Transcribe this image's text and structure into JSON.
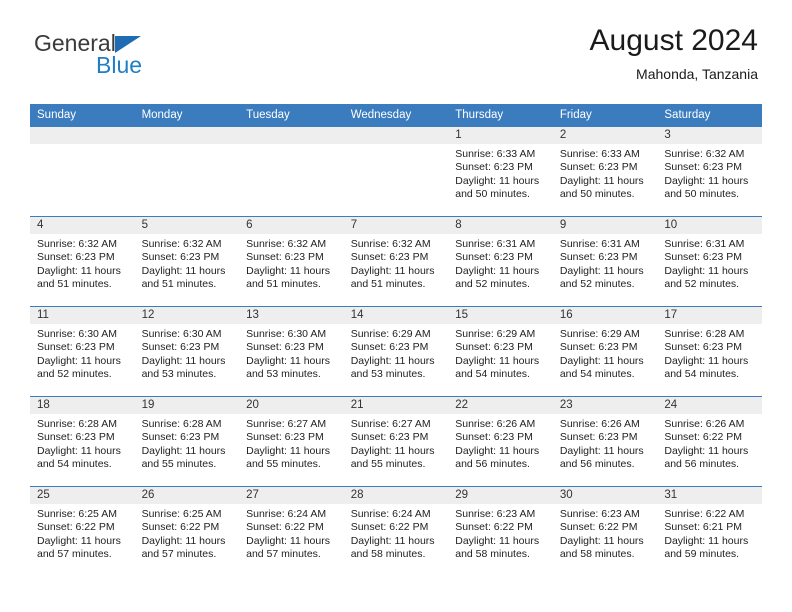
{
  "brand": {
    "name_part1": "General",
    "name_part2": "Blue",
    "logo_icon": "triangle-flag-icon",
    "accent_color": "#1f7ec6"
  },
  "header": {
    "title": "August 2024",
    "subtitle": "Mahonda, Tanzania"
  },
  "theme": {
    "header_row_color": "#3a7cbe",
    "date_band_color": "#eeeeee",
    "grid_line_color": "#3a7cbe"
  },
  "weekdays": [
    "Sunday",
    "Monday",
    "Tuesday",
    "Wednesday",
    "Thursday",
    "Friday",
    "Saturday"
  ],
  "weeks": [
    [
      {
        "day": "",
        "sunrise": "",
        "sunset": "",
        "daylight_line1": "",
        "daylight_line2": ""
      },
      {
        "day": "",
        "sunrise": "",
        "sunset": "",
        "daylight_line1": "",
        "daylight_line2": ""
      },
      {
        "day": "",
        "sunrise": "",
        "sunset": "",
        "daylight_line1": "",
        "daylight_line2": ""
      },
      {
        "day": "",
        "sunrise": "",
        "sunset": "",
        "daylight_line1": "",
        "daylight_line2": ""
      },
      {
        "day": "1",
        "sunrise": "Sunrise: 6:33 AM",
        "sunset": "Sunset: 6:23 PM",
        "daylight_line1": "Daylight: 11 hours",
        "daylight_line2": "and 50 minutes."
      },
      {
        "day": "2",
        "sunrise": "Sunrise: 6:33 AM",
        "sunset": "Sunset: 6:23 PM",
        "daylight_line1": "Daylight: 11 hours",
        "daylight_line2": "and 50 minutes."
      },
      {
        "day": "3",
        "sunrise": "Sunrise: 6:32 AM",
        "sunset": "Sunset: 6:23 PM",
        "daylight_line1": "Daylight: 11 hours",
        "daylight_line2": "and 50 minutes."
      }
    ],
    [
      {
        "day": "4",
        "sunrise": "Sunrise: 6:32 AM",
        "sunset": "Sunset: 6:23 PM",
        "daylight_line1": "Daylight: 11 hours",
        "daylight_line2": "and 51 minutes."
      },
      {
        "day": "5",
        "sunrise": "Sunrise: 6:32 AM",
        "sunset": "Sunset: 6:23 PM",
        "daylight_line1": "Daylight: 11 hours",
        "daylight_line2": "and 51 minutes."
      },
      {
        "day": "6",
        "sunrise": "Sunrise: 6:32 AM",
        "sunset": "Sunset: 6:23 PM",
        "daylight_line1": "Daylight: 11 hours",
        "daylight_line2": "and 51 minutes."
      },
      {
        "day": "7",
        "sunrise": "Sunrise: 6:32 AM",
        "sunset": "Sunset: 6:23 PM",
        "daylight_line1": "Daylight: 11 hours",
        "daylight_line2": "and 51 minutes."
      },
      {
        "day": "8",
        "sunrise": "Sunrise: 6:31 AM",
        "sunset": "Sunset: 6:23 PM",
        "daylight_line1": "Daylight: 11 hours",
        "daylight_line2": "and 52 minutes."
      },
      {
        "day": "9",
        "sunrise": "Sunrise: 6:31 AM",
        "sunset": "Sunset: 6:23 PM",
        "daylight_line1": "Daylight: 11 hours",
        "daylight_line2": "and 52 minutes."
      },
      {
        "day": "10",
        "sunrise": "Sunrise: 6:31 AM",
        "sunset": "Sunset: 6:23 PM",
        "daylight_line1": "Daylight: 11 hours",
        "daylight_line2": "and 52 minutes."
      }
    ],
    [
      {
        "day": "11",
        "sunrise": "Sunrise: 6:30 AM",
        "sunset": "Sunset: 6:23 PM",
        "daylight_line1": "Daylight: 11 hours",
        "daylight_line2": "and 52 minutes."
      },
      {
        "day": "12",
        "sunrise": "Sunrise: 6:30 AM",
        "sunset": "Sunset: 6:23 PM",
        "daylight_line1": "Daylight: 11 hours",
        "daylight_line2": "and 53 minutes."
      },
      {
        "day": "13",
        "sunrise": "Sunrise: 6:30 AM",
        "sunset": "Sunset: 6:23 PM",
        "daylight_line1": "Daylight: 11 hours",
        "daylight_line2": "and 53 minutes."
      },
      {
        "day": "14",
        "sunrise": "Sunrise: 6:29 AM",
        "sunset": "Sunset: 6:23 PM",
        "daylight_line1": "Daylight: 11 hours",
        "daylight_line2": "and 53 minutes."
      },
      {
        "day": "15",
        "sunrise": "Sunrise: 6:29 AM",
        "sunset": "Sunset: 6:23 PM",
        "daylight_line1": "Daylight: 11 hours",
        "daylight_line2": "and 54 minutes."
      },
      {
        "day": "16",
        "sunrise": "Sunrise: 6:29 AM",
        "sunset": "Sunset: 6:23 PM",
        "daylight_line1": "Daylight: 11 hours",
        "daylight_line2": "and 54 minutes."
      },
      {
        "day": "17",
        "sunrise": "Sunrise: 6:28 AM",
        "sunset": "Sunset: 6:23 PM",
        "daylight_line1": "Daylight: 11 hours",
        "daylight_line2": "and 54 minutes."
      }
    ],
    [
      {
        "day": "18",
        "sunrise": "Sunrise: 6:28 AM",
        "sunset": "Sunset: 6:23 PM",
        "daylight_line1": "Daylight: 11 hours",
        "daylight_line2": "and 54 minutes."
      },
      {
        "day": "19",
        "sunrise": "Sunrise: 6:28 AM",
        "sunset": "Sunset: 6:23 PM",
        "daylight_line1": "Daylight: 11 hours",
        "daylight_line2": "and 55 minutes."
      },
      {
        "day": "20",
        "sunrise": "Sunrise: 6:27 AM",
        "sunset": "Sunset: 6:23 PM",
        "daylight_line1": "Daylight: 11 hours",
        "daylight_line2": "and 55 minutes."
      },
      {
        "day": "21",
        "sunrise": "Sunrise: 6:27 AM",
        "sunset": "Sunset: 6:23 PM",
        "daylight_line1": "Daylight: 11 hours",
        "daylight_line2": "and 55 minutes."
      },
      {
        "day": "22",
        "sunrise": "Sunrise: 6:26 AM",
        "sunset": "Sunset: 6:23 PM",
        "daylight_line1": "Daylight: 11 hours",
        "daylight_line2": "and 56 minutes."
      },
      {
        "day": "23",
        "sunrise": "Sunrise: 6:26 AM",
        "sunset": "Sunset: 6:23 PM",
        "daylight_line1": "Daylight: 11 hours",
        "daylight_line2": "and 56 minutes."
      },
      {
        "day": "24",
        "sunrise": "Sunrise: 6:26 AM",
        "sunset": "Sunset: 6:22 PM",
        "daylight_line1": "Daylight: 11 hours",
        "daylight_line2": "and 56 minutes."
      }
    ],
    [
      {
        "day": "25",
        "sunrise": "Sunrise: 6:25 AM",
        "sunset": "Sunset: 6:22 PM",
        "daylight_line1": "Daylight: 11 hours",
        "daylight_line2": "and 57 minutes."
      },
      {
        "day": "26",
        "sunrise": "Sunrise: 6:25 AM",
        "sunset": "Sunset: 6:22 PM",
        "daylight_line1": "Daylight: 11 hours",
        "daylight_line2": "and 57 minutes."
      },
      {
        "day": "27",
        "sunrise": "Sunrise: 6:24 AM",
        "sunset": "Sunset: 6:22 PM",
        "daylight_line1": "Daylight: 11 hours",
        "daylight_line2": "and 57 minutes."
      },
      {
        "day": "28",
        "sunrise": "Sunrise: 6:24 AM",
        "sunset": "Sunset: 6:22 PM",
        "daylight_line1": "Daylight: 11 hours",
        "daylight_line2": "and 58 minutes."
      },
      {
        "day": "29",
        "sunrise": "Sunrise: 6:23 AM",
        "sunset": "Sunset: 6:22 PM",
        "daylight_line1": "Daylight: 11 hours",
        "daylight_line2": "and 58 minutes."
      },
      {
        "day": "30",
        "sunrise": "Sunrise: 6:23 AM",
        "sunset": "Sunset: 6:22 PM",
        "daylight_line1": "Daylight: 11 hours",
        "daylight_line2": "and 58 minutes."
      },
      {
        "day": "31",
        "sunrise": "Sunrise: 6:22 AM",
        "sunset": "Sunset: 6:21 PM",
        "daylight_line1": "Daylight: 11 hours",
        "daylight_line2": "and 59 minutes."
      }
    ]
  ]
}
